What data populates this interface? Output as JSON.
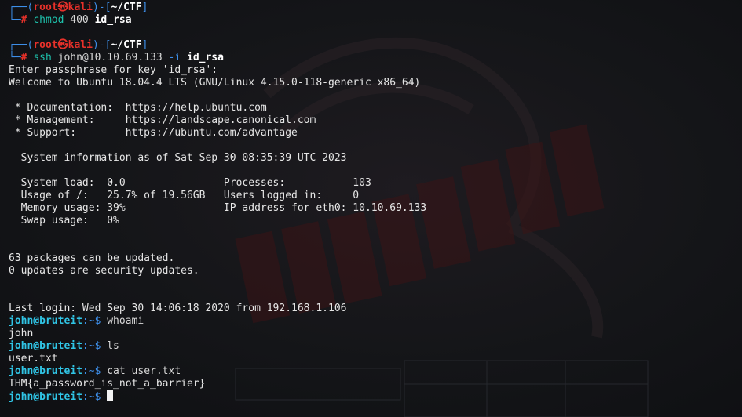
{
  "theme": {
    "background": "#131417",
    "prompt_red": "#e8312a",
    "prompt_blue": "#3d8ee8",
    "prompt_user": "#30c5e6"
  },
  "background_art": {
    "logo_text": "DARK HACK",
    "icon": "dragon-logo"
  },
  "session": {
    "prompt1": {
      "bracket_open": "┌──(",
      "user_host_user": "root",
      "skull": "㉿",
      "user_host_host": "kali",
      "bracket_mid": ")-[",
      "cwd": "~/CTF",
      "bracket_close": "]",
      "corner": "└─",
      "hash": "#",
      "cmd_name": "chmod",
      "cmd_args": " 400 ",
      "cmd_file": "id_rsa"
    },
    "prompt2": {
      "bracket_open": "┌──(",
      "user_host_user": "root",
      "skull": "㉿",
      "user_host_host": "kali",
      "bracket_mid": ")-[",
      "cwd": "~/CTF",
      "bracket_close": "]",
      "corner": "└─",
      "hash": "#",
      "cmd_name": "ssh",
      "cmd_args": " john@10.10.69.133 ",
      "cmd_flag": "-i",
      "cmd_space": " ",
      "cmd_file": "id_rsa"
    },
    "output": {
      "passphrase": "Enter passphrase for key 'id_rsa':",
      "welcome": "Welcome to Ubuntu 18.04.4 LTS (GNU/Linux 4.15.0-118-generic x86_64)",
      "doc": " * Documentation:  https://help.ubuntu.com",
      "mgmt": " * Management:     https://landscape.canonical.com",
      "support": " * Support:        https://ubuntu.com/advantage",
      "sysinfo": "  System information as of Sat Sep 30 08:35:39 UTC 2023",
      "row1": "  System load:  0.0                Processes:           103",
      "row2": "  Usage of /:   25.7% of 19.56GB   Users logged in:     0",
      "row3": "  Memory usage: 39%                IP address for eth0: 10.10.69.133",
      "row4": "  Swap usage:   0%",
      "pkgs": "63 packages can be updated.",
      "security": "0 updates are security updates.",
      "last_login": "Last login: Wed Sep 30 14:06:18 2020 from 192.168.1.106"
    },
    "john_prompts": [
      {
        "user": "john@bruteit",
        "sep": ":~$ ",
        "cmd": "whoami",
        "out": "john"
      },
      {
        "user": "john@bruteit",
        "sep": ":~$ ",
        "cmd": "ls",
        "out": "user.txt"
      },
      {
        "user": "john@bruteit",
        "sep": ":~$ ",
        "cmd": "cat user.txt",
        "out": "THM{a_password_is_not_a_barrier}"
      }
    ],
    "final_prompt": {
      "user": "john@bruteit",
      "sep": ":~$ "
    }
  }
}
